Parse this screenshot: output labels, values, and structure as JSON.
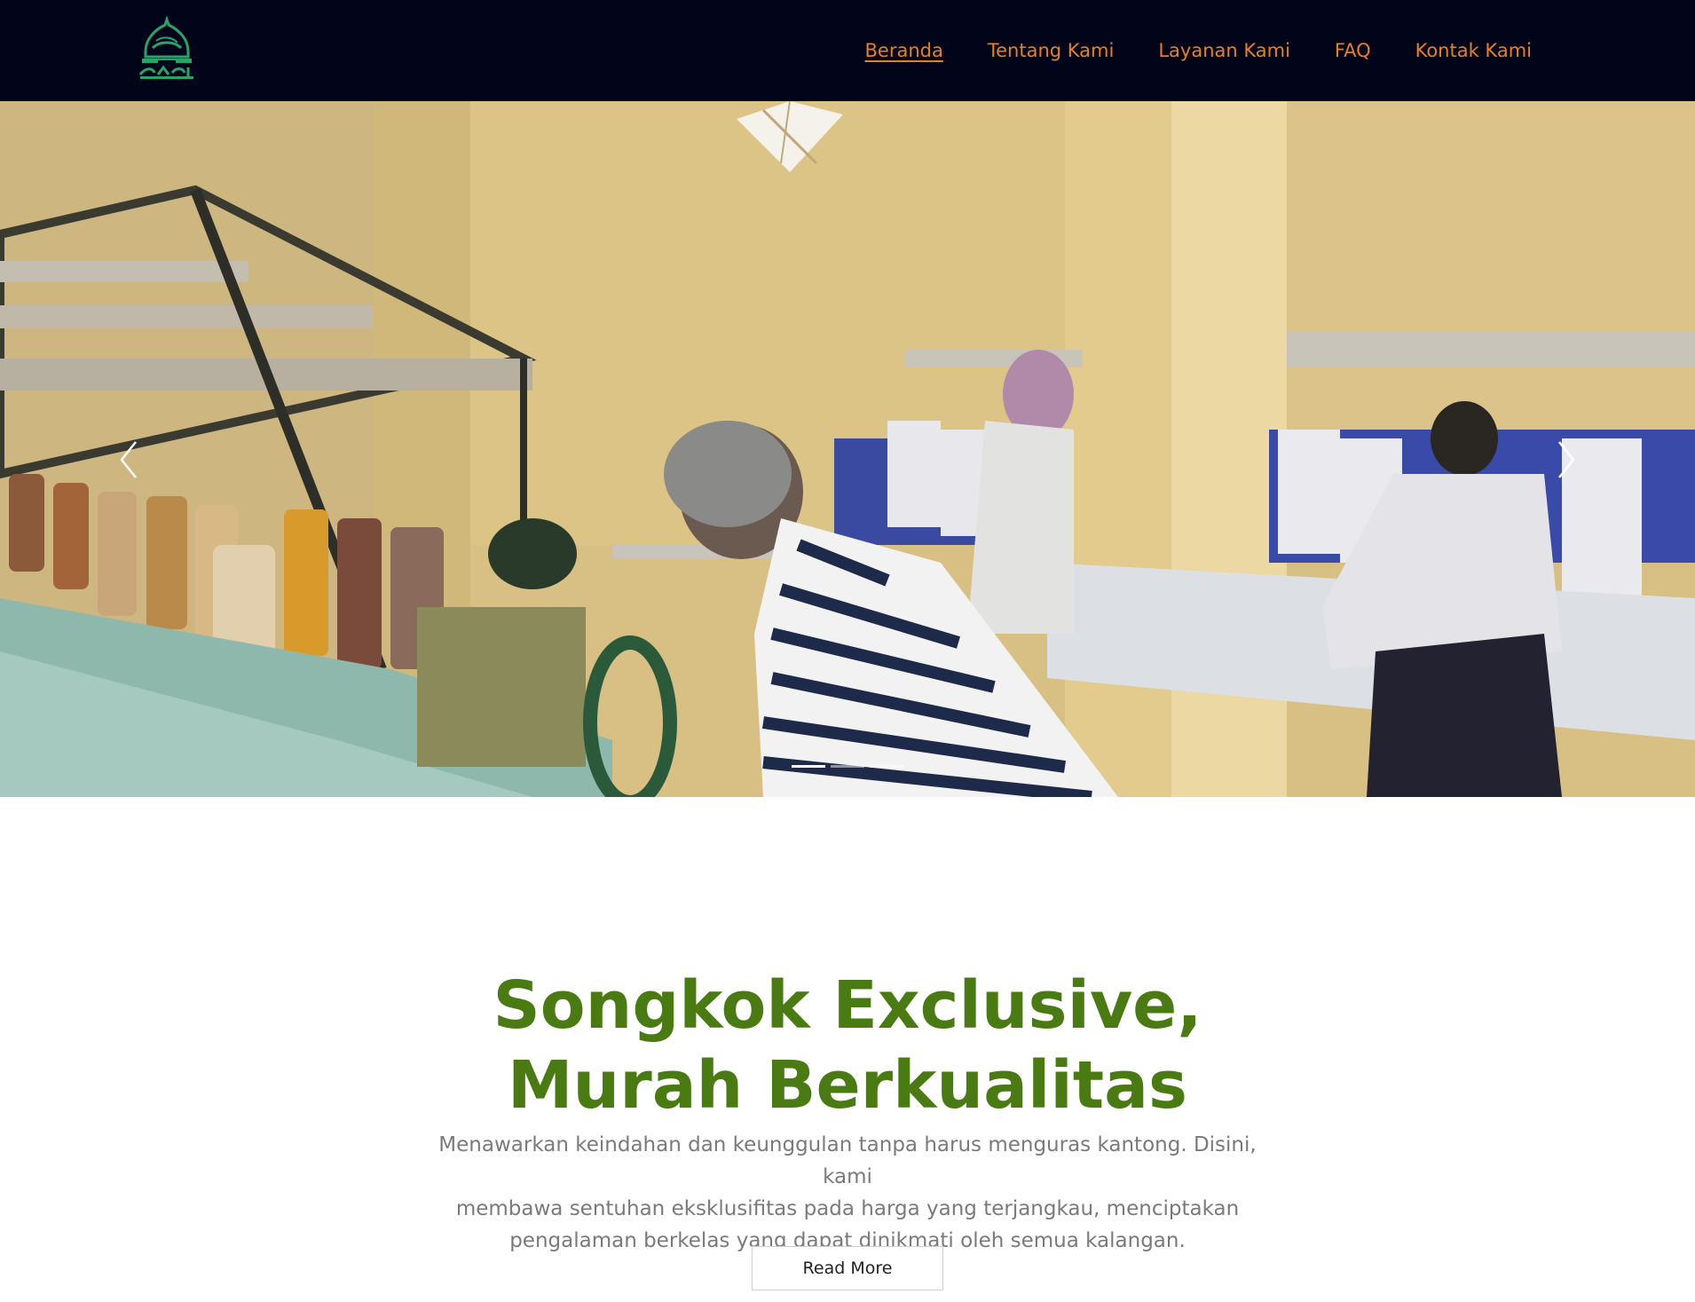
{
  "nav": {
    "items": [
      {
        "label": "Beranda",
        "active": true
      },
      {
        "label": "Tentang Kami",
        "active": false
      },
      {
        "label": "Layanan Kami",
        "active": false
      },
      {
        "label": "FAQ",
        "active": false
      },
      {
        "label": "Kontak Kami",
        "active": false
      }
    ],
    "accent_color": "#e8801f",
    "background": "#02051a"
  },
  "logo": {
    "icon": "mosque-dome-logo-icon",
    "color": "#2aa36a"
  },
  "carousel": {
    "image": "embroidery-factory-workers-photo",
    "prev_icon": "chevron-left-icon",
    "next_icon": "chevron-right-icon",
    "slide_count": 3,
    "active_slide": 1
  },
  "intro": {
    "headline_line1": "Songkok Exclusive,",
    "headline_line2": "Murah Berkualitas",
    "headline_color": "#4a7a12",
    "lead_line1": "Menawarkan keindahan dan keunggulan tanpa harus menguras kantong. Disini, kami",
    "lead_line2": "membawa sentuhan eksklusifitas pada harga yang terjangkau, menciptakan",
    "lead_line3": "pengalaman berkelas yang dapat dinikmati oleh semua kalangan.",
    "button_label": "Read More"
  }
}
